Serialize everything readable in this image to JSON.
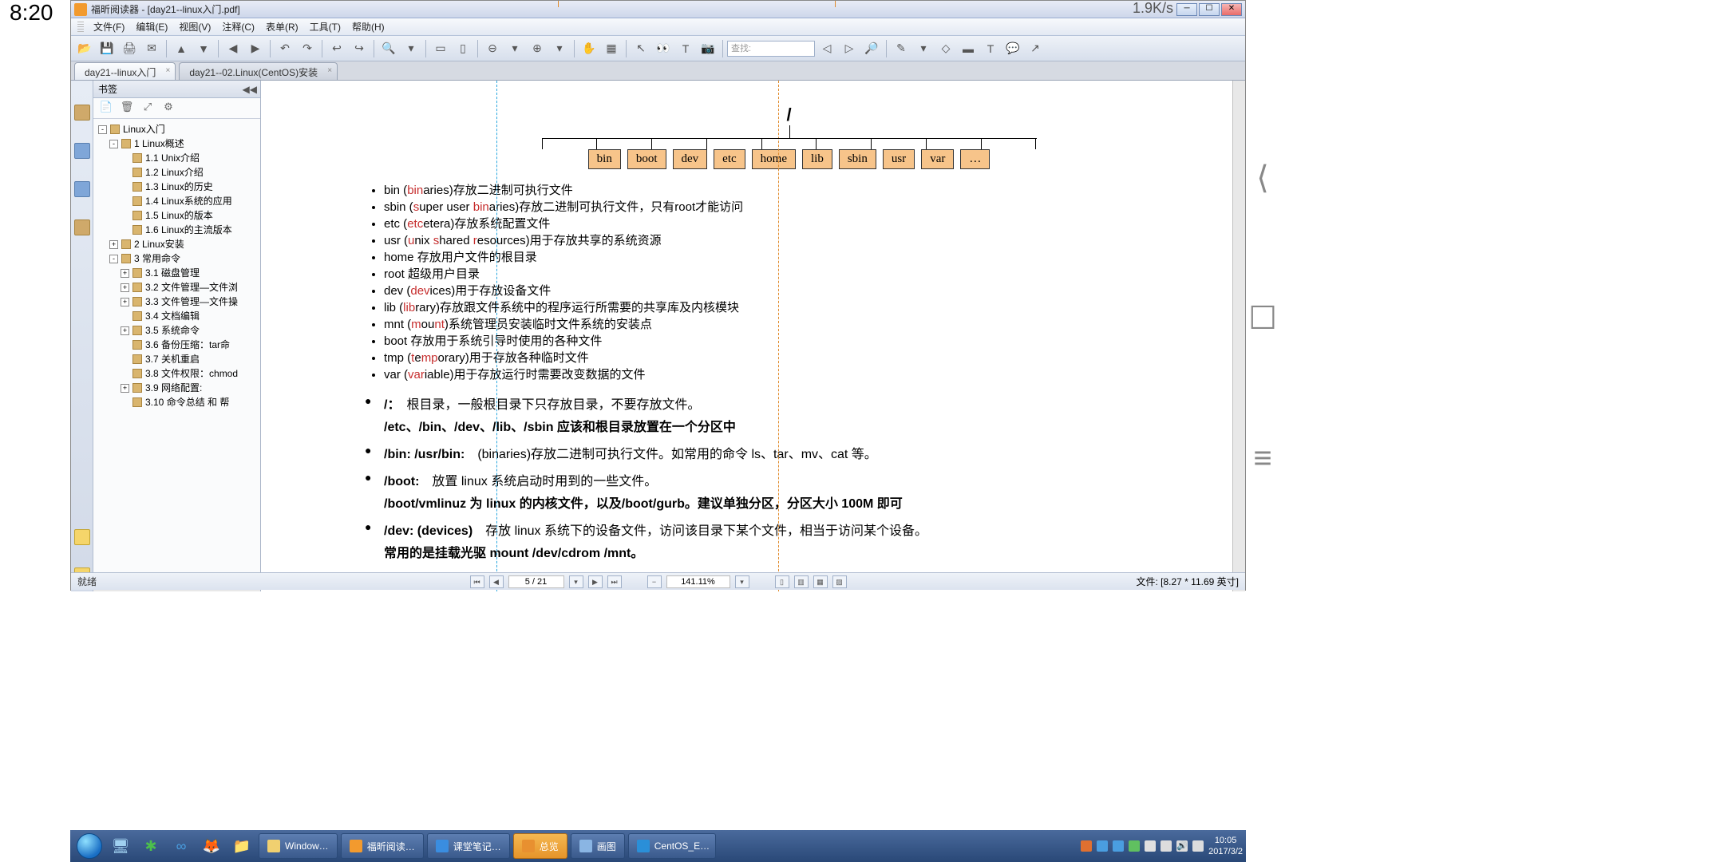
{
  "clock": "8:20",
  "net_speed": "1.9K/s",
  "title": "福昕阅读器 - [day21--linux入门.pdf]",
  "menu": [
    "文件(F)",
    "编辑(E)",
    "视图(V)",
    "注释(C)",
    "表单(R)",
    "工具(T)",
    "帮助(H)"
  ],
  "search_placeholder": "查找:",
  "tabs": [
    {
      "label": "day21--linux入门",
      "active": true
    },
    {
      "label": "day21--02.Linux(CentOS)安装",
      "active": false
    }
  ],
  "bookmarks": {
    "title": "书签",
    "tree": [
      {
        "d": 0,
        "exp": "-",
        "label": "Linux入门"
      },
      {
        "d": 1,
        "exp": "-",
        "label": "1 Linux概述"
      },
      {
        "d": 2,
        "label": "1.1 Unix介绍"
      },
      {
        "d": 2,
        "label": "1.2 Linux介绍"
      },
      {
        "d": 2,
        "label": "1.3 Linux的历史"
      },
      {
        "d": 2,
        "label": "1.4 Linux系统的应用"
      },
      {
        "d": 2,
        "label": "1.5 Linux的版本"
      },
      {
        "d": 2,
        "label": "1.6 Linux的主流版本"
      },
      {
        "d": 1,
        "exp": "+",
        "label": "2 Linux安装"
      },
      {
        "d": 1,
        "exp": "-",
        "label": "3 常用命令"
      },
      {
        "d": 2,
        "exp": "+",
        "label": "3.1 磁盘管理"
      },
      {
        "d": 2,
        "exp": "+",
        "label": "3.2 文件管理—文件浏"
      },
      {
        "d": 2,
        "exp": "+",
        "label": "3.3 文件管理—文件操"
      },
      {
        "d": 2,
        "label": "3.4 文档编辑"
      },
      {
        "d": 2,
        "exp": "+",
        "label": "3.5 系统命令"
      },
      {
        "d": 2,
        "label": "3.6 备份压缩：tar命"
      },
      {
        "d": 2,
        "label": "3.7 关机重启"
      },
      {
        "d": 2,
        "label": "3.8 文件权限：chmod"
      },
      {
        "d": 2,
        "exp": "+",
        "label": "3.9 网络配置:"
      },
      {
        "d": 2,
        "label": "3.10 命令总结 和 帮"
      }
    ]
  },
  "doc": {
    "dirs": [
      "bin",
      "boot",
      "dev",
      "etc",
      "home",
      "lib",
      "sbin",
      "usr",
      "var",
      "…"
    ],
    "root": "/",
    "defs": [
      {
        "pre": "bin (",
        "hl": "bin",
        "post": "aries)存放二进制可执行文件"
      },
      {
        "pre": "sbin (",
        "hl": "s",
        "mid": "uper user ",
        "hl2": "bin",
        "post": "aries)存放二进制可执行文件，只有root才能访问"
      },
      {
        "pre": "etc (",
        "hl": "etc",
        "post": "etera)存放系统配置文件"
      },
      {
        "pre": "usr (",
        "hl": "u",
        "mid": "nix ",
        "hl2": "s",
        "mid2": "hared ",
        "hl3": "r",
        "post": "esources)用于存放共享的系统资源"
      },
      {
        "plain": "home 存放用户文件的根目录"
      },
      {
        "plain": "root 超级用户目录"
      },
      {
        "pre": "dev (",
        "hl": "dev",
        "post": "ices)用于存放设备文件"
      },
      {
        "pre": "lib (",
        "hl": "lib",
        "post": "rary)存放跟文件系统中的程序运行所需要的共享库及内核模块"
      },
      {
        "pre": "mnt (",
        "hl": "m",
        "mid": "ou",
        "hl2": "nt",
        "post": ")系统管理员安装临时文件系统的安装点"
      },
      {
        "plain": "boot 存放用于系统引导时使用的各种文件"
      },
      {
        "pre": "tmp (",
        "hl": "t",
        "mid": "e",
        "hl2": "mp",
        "post": "orary)用于存放各种临时文件"
      },
      {
        "pre": "var (",
        "hl": "var",
        "post": "iable)用于存放运行时需要改变数据的文件"
      }
    ],
    "paras": [
      {
        "head": "/：",
        "body": "根目录，一般根目录下只存放目录，不要存放文件。",
        "cont": "/etc、/bin、/dev、/lib、/sbin 应该和根目录放置在一个分区中"
      },
      {
        "head": "/bin: /usr/bin:",
        "body": "(binaries)存放二进制可执行文件。如常用的命令 ls、tar、mv、cat 等。"
      },
      {
        "head": "/boot:",
        "body": "放置 linux 系统启动时用到的一些文件。",
        "cont": "/boot/vmlinuz 为 linux 的内核文件，以及/boot/gurb。建议单独分区，分区大小 100M 即可"
      },
      {
        "head": "/dev: (devices)",
        "body": "存放 linux 系统下的设备文件，访问该目录下某个文件，相当于访问某个设备。",
        "cont": "常用的是挂载光驱 mount /dev/cdrom /mnt。"
      }
    ]
  },
  "status": {
    "left": "就绪",
    "page": "5 / 21",
    "zoom": "141.11%",
    "file": "文件: [8.27 * 11.69 英寸]"
  },
  "taskbar": [
    {
      "label": "Window…",
      "color": "#5d7eb1",
      "ic": "#f0d070"
    },
    {
      "label": "福昕阅读…",
      "color": "#5d7eb1",
      "ic": "#f29a2e"
    },
    {
      "label": "课堂笔记…",
      "color": "#5d7eb1",
      "ic": "#3a8de0"
    },
    {
      "label": "总览",
      "color": "active",
      "ic": "#e89030"
    },
    {
      "label": "画图",
      "color": "#5d7eb1",
      "ic": "#8ab5e3"
    },
    {
      "label": "CentOS_E…",
      "color": "#5d7eb1",
      "ic": "#2a8fd8"
    }
  ],
  "tray_time": "10:05",
  "tray_date": "2017/3/2"
}
